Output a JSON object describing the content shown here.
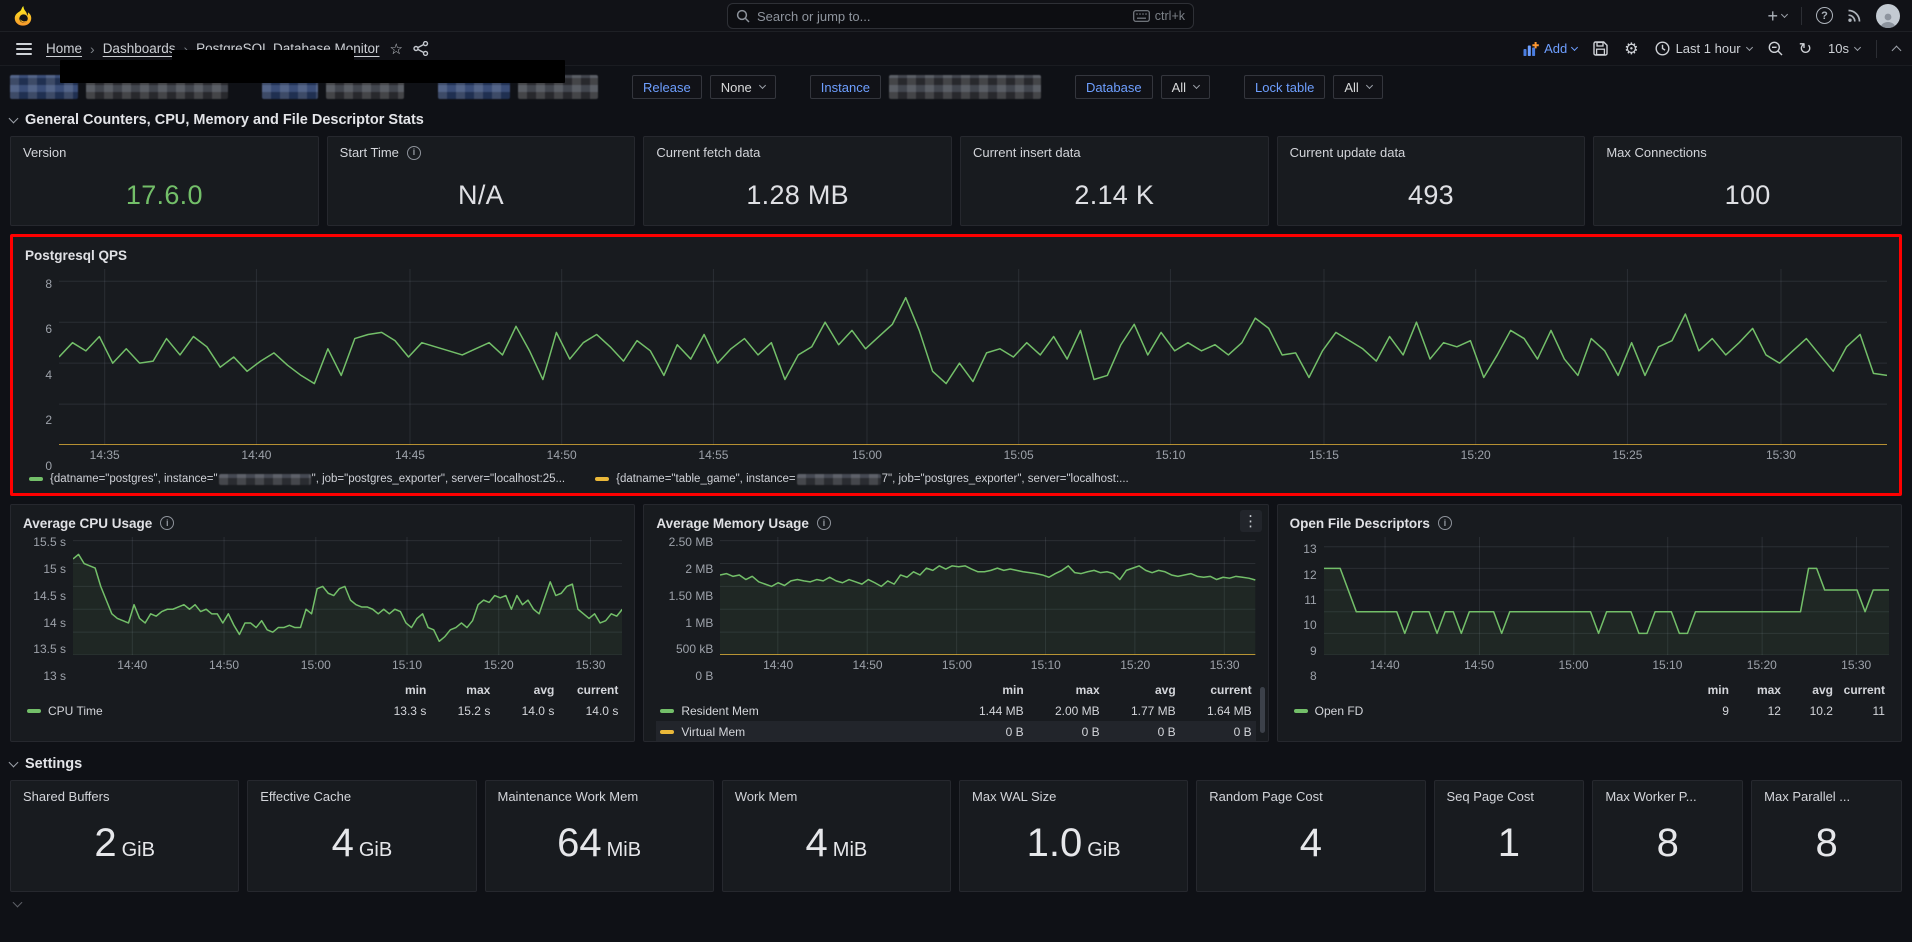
{
  "topnav": {
    "search_placeholder": "Search or jump to...",
    "shortcut": "ctrl+k",
    "plus_label": "+"
  },
  "breadcrumb": {
    "items": [
      "Home",
      "Dashboards",
      "PostgreSQL Database Monitor"
    ]
  },
  "toolbar": {
    "add_label": "Add",
    "time_range": "Last 1 hour",
    "refresh_interval": "10s"
  },
  "variables": {
    "release": {
      "label": "Release",
      "value": "None"
    },
    "instance": {
      "label": "Instance"
    },
    "database": {
      "label": "Database",
      "value": "All"
    },
    "lock_table": {
      "label": "Lock table",
      "value": "All"
    }
  },
  "sections": {
    "general": "General Counters, CPU, Memory and File Descriptor Stats",
    "settings": "Settings"
  },
  "stats": [
    {
      "title": "Version",
      "value": "17.6.0"
    },
    {
      "title": "Start Time",
      "value": "N/A"
    },
    {
      "title": "Current fetch data",
      "value": "1.28 MB"
    },
    {
      "title": "Current insert data",
      "value": "2.14 K"
    },
    {
      "title": "Current update data",
      "value": "493"
    },
    {
      "title": "Max Connections",
      "value": "100"
    }
  ],
  "panels": {
    "qps": {
      "title": "Postgresql QPS"
    },
    "cpu": {
      "title": "Average CPU Usage"
    },
    "mem": {
      "title": "Average Memory Usage"
    },
    "fd": {
      "title": "Open File Descriptors"
    }
  },
  "qps_legend": [
    {
      "color": "#73bf69",
      "pre": "{datname=\"postgres\", instance=\"",
      "post": "\", job=\"postgres_exporter\", server=\"localhost:25...",
      "redact_w": 92
    },
    {
      "color": "#eab839",
      "pre": "{datname=\"table_game\", instance=",
      "post": "7\", job=\"postgres_exporter\", server=\"localhost:...",
      "redact_w": 84
    }
  ],
  "settings": [
    {
      "title": "Shared Buffers",
      "num": "2",
      "unit": "GiB"
    },
    {
      "title": "Effective Cache",
      "num": "4",
      "unit": "GiB"
    },
    {
      "title": "Maintenance Work Mem",
      "num": "64",
      "unit": "MiB"
    },
    {
      "title": "Work Mem",
      "num": "4",
      "unit": "MiB"
    },
    {
      "title": "Max WAL Size",
      "num": "1.0",
      "unit": "GiB"
    },
    {
      "title": "Random Page Cost",
      "num": "4",
      "unit": ""
    },
    {
      "title": "Seq Page Cost",
      "num": "1",
      "unit": ""
    },
    {
      "title": "Max Worker P...",
      "num": "8",
      "unit": ""
    },
    {
      "title": "Max Parallel ...",
      "num": "8",
      "unit": ""
    }
  ],
  "chart_data": [
    {
      "type": "line",
      "title": "Postgresql QPS",
      "ylim": [
        0,
        8.6
      ],
      "y_ticks": [
        {
          "label": "8",
          "value": 8
        },
        {
          "label": "6",
          "value": 6
        },
        {
          "label": "4",
          "value": 4
        },
        {
          "label": "2",
          "value": 2
        },
        {
          "label": "0",
          "value": 0
        }
      ],
      "x_ticks": [
        {
          "label": "14:35",
          "pos": 0.025
        },
        {
          "label": "14:40",
          "pos": 0.108
        },
        {
          "label": "14:45",
          "pos": 0.192
        },
        {
          "label": "14:50",
          "pos": 0.275
        },
        {
          "label": "14:55",
          "pos": 0.358
        },
        {
          "label": "15:00",
          "pos": 0.442
        },
        {
          "label": "15:05",
          "pos": 0.525
        },
        {
          "label": "15:10",
          "pos": 0.608
        },
        {
          "label": "15:15",
          "pos": 0.692
        },
        {
          "label": "15:20",
          "pos": 0.775
        },
        {
          "label": "15:25",
          "pos": 0.858
        },
        {
          "label": "15:30",
          "pos": 0.942
        }
      ],
      "series": [
        {
          "name": "datname=postgres",
          "color": "#73bf69",
          "fill": false,
          "values": [
            4.3,
            5.0,
            4.6,
            5.3,
            4.0,
            4.7,
            4.0,
            4.1,
            5.2,
            4.4,
            5.3,
            4.8,
            3.8,
            4.3,
            3.6,
            4.1,
            4.5,
            3.9,
            3.4,
            3.0,
            4.7,
            3.4,
            5.2,
            5.4,
            5.5,
            5.1,
            4.3,
            5.0,
            4.8,
            4.6,
            4.4,
            4.7,
            5.0,
            4.4,
            5.8,
            4.6,
            3.2,
            5.5,
            4.2,
            5.0,
            5.4,
            4.8,
            4.1,
            5.1,
            4.6,
            3.4,
            4.9,
            4.2,
            5.4,
            4.0,
            4.7,
            5.2,
            4.4,
            5.0,
            3.2,
            4.4,
            4.8,
            6.0,
            4.9,
            5.6,
            4.7,
            5.3,
            5.9,
            7.2,
            5.6,
            3.6,
            3.0,
            4.0,
            3.1,
            4.5,
            4.7,
            4.3,
            5.0,
            4.4,
            5.3,
            4.2,
            5.6,
            3.2,
            3.4,
            4.9,
            5.9,
            4.4,
            5.5,
            4.6,
            5.0,
            4.6,
            4.9,
            4.4,
            5.0,
            6.2,
            5.7,
            4.4,
            4.5,
            3.3,
            4.6,
            5.5,
            5.1,
            4.7,
            4.1,
            5.3,
            4.4,
            6.0,
            4.2,
            5.0,
            4.8,
            5.1,
            3.3,
            4.4,
            5.6,
            5.2,
            4.2,
            5.6,
            4.2,
            3.4,
            5.2,
            4.6,
            3.4,
            5.0,
            3.4,
            4.8,
            5.1,
            6.4,
            4.6,
            5.2,
            4.4,
            5.0,
            5.7,
            4.4,
            4.0,
            4.6,
            5.2,
            4.4,
            3.6,
            4.8,
            5.4,
            3.5,
            3.4
          ]
        },
        {
          "name": "datname=table_game",
          "color": "#eab839",
          "fill": false,
          "values": [
            0,
            0
          ]
        }
      ]
    },
    {
      "type": "line",
      "title": "Average CPU Usage",
      "ylim": [
        13,
        15.58
      ],
      "y_ticks": [
        {
          "label": "15.5 s",
          "value": 15.5
        },
        {
          "label": "15 s",
          "value": 15
        },
        {
          "label": "14.5 s",
          "value": 14.5
        },
        {
          "label": "14 s",
          "value": 14
        },
        {
          "label": "13.5 s",
          "value": 13.5
        },
        {
          "label": "13 s",
          "value": 13
        }
      ],
      "x_ticks": [
        {
          "label": "14:40",
          "pos": 0.108
        },
        {
          "label": "14:50",
          "pos": 0.275
        },
        {
          "label": "15:00",
          "pos": 0.442
        },
        {
          "label": "15:10",
          "pos": 0.608
        },
        {
          "label": "15:20",
          "pos": 0.775
        },
        {
          "label": "15:30",
          "pos": 0.942
        }
      ],
      "series": [
        {
          "name": "CPU Time",
          "color": "#73bf69",
          "fill": true,
          "values": [
            15.1,
            15.2,
            15.0,
            14.95,
            14.9,
            14.5,
            14.2,
            13.9,
            13.8,
            13.75,
            13.7,
            14.1,
            13.8,
            13.7,
            13.9,
            13.85,
            13.95,
            14.0,
            14.0,
            14.05,
            14.1,
            14.0,
            14.1,
            13.95,
            14.0,
            13.9,
            13.9,
            13.7,
            13.9,
            13.65,
            13.45,
            13.7,
            13.7,
            13.6,
            13.75,
            13.55,
            13.5,
            13.6,
            13.6,
            13.65,
            13.6,
            13.6,
            14.0,
            13.9,
            14.45,
            14.5,
            14.35,
            14.3,
            14.45,
            14.5,
            14.2,
            14.1,
            14.05,
            14.05,
            14.0,
            13.9,
            14.0,
            13.9,
            14.0,
            13.95,
            13.7,
            13.6,
            13.8,
            13.9,
            13.6,
            13.55,
            13.3,
            13.4,
            13.55,
            13.6,
            13.7,
            13.6,
            13.75,
            14.1,
            14.2,
            14.15,
            14.3,
            14.25,
            14.3,
            14.0,
            14.3,
            14.1,
            14.2,
            14.0,
            13.9,
            14.25,
            14.6,
            14.3,
            14.35,
            14.5,
            14.55,
            14.0,
            13.9,
            13.8,
            13.9,
            13.7,
            13.75,
            13.9,
            13.85,
            14.0
          ]
        }
      ],
      "legend": {
        "headers": [
          "min",
          "max",
          "avg",
          "current"
        ],
        "rows": [
          {
            "name": "CPU Time",
            "color": "#73bf69",
            "values": [
              "13.3 s",
              "15.2 s",
              "14.0 s",
              "14.0 s"
            ],
            "hl": false
          }
        ]
      }
    },
    {
      "type": "line",
      "title": "Average Memory Usage",
      "ylim": [
        0,
        2.58
      ],
      "y_ticks": [
        {
          "label": "2.50 MB",
          "value": 2.5
        },
        {
          "label": "2 MB",
          "value": 2
        },
        {
          "label": "1.50 MB",
          "value": 1.5
        },
        {
          "label": "1 MB",
          "value": 1
        },
        {
          "label": "500 kB",
          "value": 0.5
        },
        {
          "label": "0 B",
          "value": 0
        }
      ],
      "x_ticks": [
        {
          "label": "14:40",
          "pos": 0.108
        },
        {
          "label": "14:50",
          "pos": 0.275
        },
        {
          "label": "15:00",
          "pos": 0.442
        },
        {
          "label": "15:10",
          "pos": 0.608
        },
        {
          "label": "15:20",
          "pos": 0.775
        },
        {
          "label": "15:30",
          "pos": 0.942
        }
      ],
      "series": [
        {
          "name": "Resident Mem",
          "color": "#73bf69",
          "fill": true,
          "values": [
            1.75,
            1.78,
            1.72,
            1.75,
            1.65,
            1.72,
            1.6,
            1.55,
            1.5,
            1.58,
            1.52,
            1.62,
            1.65,
            1.62,
            1.6,
            1.65,
            1.62,
            1.7,
            1.62,
            1.58,
            1.65,
            1.6,
            1.55,
            1.65,
            1.58,
            1.5,
            1.62,
            1.55,
            1.75,
            1.7,
            1.82,
            1.75,
            1.9,
            1.85,
            1.95,
            1.88,
            1.95,
            1.93,
            1.95,
            1.88,
            1.82,
            1.82,
            1.85,
            1.9,
            1.85,
            1.88,
            1.85,
            1.82,
            1.8,
            1.78,
            1.75,
            1.7,
            1.78,
            1.85,
            1.95,
            1.8,
            1.78,
            1.82,
            1.85,
            1.8,
            1.82,
            1.78,
            1.65,
            1.85,
            1.9,
            1.95,
            1.85,
            1.8,
            1.85,
            1.82,
            1.75,
            1.72,
            1.75,
            1.78,
            1.72,
            1.7,
            1.72,
            1.65,
            1.7,
            1.68,
            1.72,
            1.7,
            1.68,
            1.64
          ]
        },
        {
          "name": "Virtual Mem",
          "color": "#eab839",
          "fill": false,
          "values": [
            0,
            0
          ]
        }
      ],
      "legend": {
        "headers": [
          "min",
          "max",
          "avg",
          "current"
        ],
        "rows": [
          {
            "name": "Resident Mem",
            "color": "#73bf69",
            "values": [
              "1.44 MB",
              "2.00 MB",
              "1.77 MB",
              "1.64 MB"
            ],
            "hl": false
          },
          {
            "name": "Virtual Mem",
            "color": "#eab839",
            "values": [
              "0 B",
              "0 B",
              "0 B",
              "0 B"
            ],
            "hl": true
          }
        ]
      }
    },
    {
      "type": "line",
      "title": "Open File Descriptors",
      "ylim": [
        8,
        13.45
      ],
      "y_ticks": [
        {
          "label": "13",
          "value": 13
        },
        {
          "label": "12",
          "value": 12
        },
        {
          "label": "11",
          "value": 11
        },
        {
          "label": "10",
          "value": 10
        },
        {
          "label": "9",
          "value": 9
        },
        {
          "label": "8",
          "value": 8
        }
      ],
      "x_ticks": [
        {
          "label": "14:40",
          "pos": 0.108
        },
        {
          "label": "14:50",
          "pos": 0.275
        },
        {
          "label": "15:00",
          "pos": 0.442
        },
        {
          "label": "15:10",
          "pos": 0.608
        },
        {
          "label": "15:20",
          "pos": 0.775
        },
        {
          "label": "15:30",
          "pos": 0.942
        }
      ],
      "series": [
        {
          "name": "Open FD",
          "color": "#73bf69",
          "fill": true,
          "values": [
            12,
            12,
            12,
            11,
            10,
            10,
            10,
            10,
            10,
            10,
            9,
            10,
            10,
            10,
            9,
            10,
            10,
            9,
            10,
            10,
            10,
            10,
            9,
            10,
            10,
            10,
            10,
            10,
            10,
            10,
            10,
            10,
            10,
            10,
            9,
            10,
            10,
            10,
            10,
            9,
            9,
            10,
            10,
            10,
            9,
            9,
            10,
            10,
            10,
            10,
            10,
            10,
            10,
            10,
            10,
            10,
            10,
            10,
            10,
            10,
            12,
            12,
            11,
            11,
            11,
            11,
            11,
            10,
            11,
            11,
            11
          ]
        }
      ],
      "legend": {
        "headers": [
          "min",
          "max",
          "avg",
          "current"
        ],
        "rows": [
          {
            "name": "Open FD",
            "color": "#73bf69",
            "values": [
              "9",
              "12",
              "10.2",
              "11"
            ],
            "hl": false
          }
        ]
      }
    }
  ]
}
